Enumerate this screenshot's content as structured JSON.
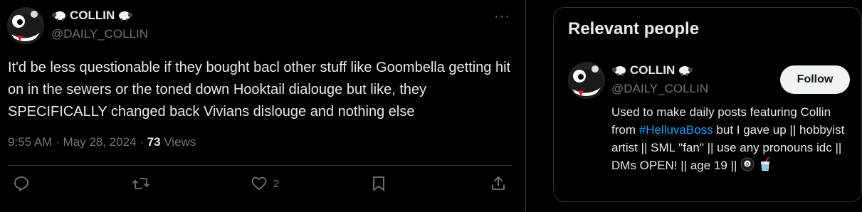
{
  "post": {
    "display_name": "COLLIN",
    "handle": "@DAILY_COLLIN",
    "text": "It'd be less questionable if they bought bacl other stuff like Goombella getting hit on in the sewers or the toned down Hooktail dialouge but like, they SPECIFICALLY changed back Vivians dislouge and nothing else",
    "time": "9:55 AM · May 28, 2024 · ",
    "views_count": "73",
    "views_label": " Views",
    "more_label": "···",
    "actions": {
      "reply_icon": "reply-icon",
      "repost_icon": "repost-icon",
      "like_icon": "heart-icon",
      "like_count": "2",
      "bookmark_icon": "bookmark-icon",
      "share_icon": "share-icon"
    }
  },
  "relevant_people": {
    "title": "Relevant people",
    "person": {
      "display_name": "COLLIN",
      "handle": "@DAILY_COLLIN",
      "follow_label": "Follow",
      "bio_before": "Used to make daily posts featuring Collin from ",
      "bio_hashtag": "#HelluvaBoss",
      "bio_after": " but I gave up || hobbyist artist || SML \"fan\" || use any pronouns idc || DMs OPEN! || age 19 ||"
    }
  },
  "colors": {
    "background": "#000000",
    "text": "#e7e9ea",
    "muted": "#71767b",
    "link": "#1d9bf0",
    "border": "#2f3336"
  }
}
